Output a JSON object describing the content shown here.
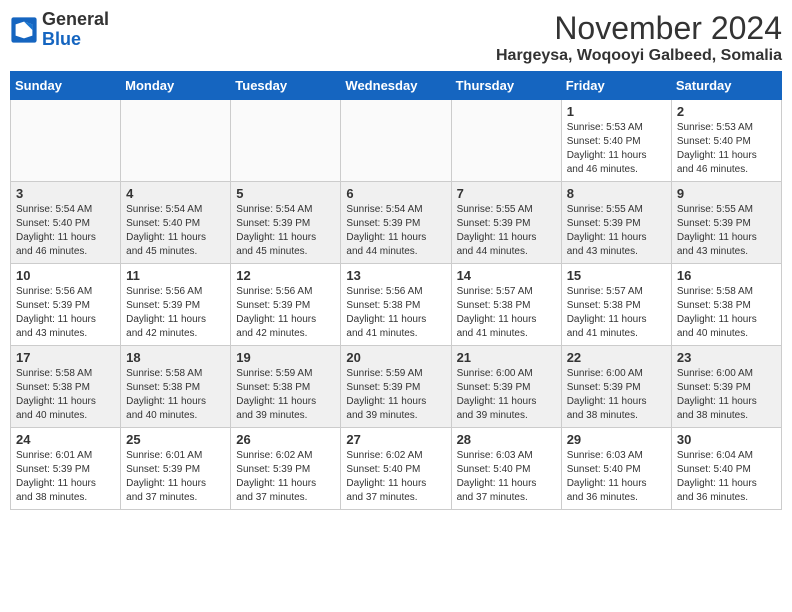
{
  "logo": {
    "general": "General",
    "blue": "Blue"
  },
  "header": {
    "month": "November 2024",
    "location": "Hargeysa, Woqooyi Galbeed, Somalia"
  },
  "weekdays": [
    "Sunday",
    "Monday",
    "Tuesday",
    "Wednesday",
    "Thursday",
    "Friday",
    "Saturday"
  ],
  "weeks": [
    [
      {
        "day": "",
        "info": ""
      },
      {
        "day": "",
        "info": ""
      },
      {
        "day": "",
        "info": ""
      },
      {
        "day": "",
        "info": ""
      },
      {
        "day": "",
        "info": ""
      },
      {
        "day": "1",
        "info": "Sunrise: 5:53 AM\nSunset: 5:40 PM\nDaylight: 11 hours and 46 minutes."
      },
      {
        "day": "2",
        "info": "Sunrise: 5:53 AM\nSunset: 5:40 PM\nDaylight: 11 hours and 46 minutes."
      }
    ],
    [
      {
        "day": "3",
        "info": "Sunrise: 5:54 AM\nSunset: 5:40 PM\nDaylight: 11 hours and 46 minutes."
      },
      {
        "day": "4",
        "info": "Sunrise: 5:54 AM\nSunset: 5:40 PM\nDaylight: 11 hours and 45 minutes."
      },
      {
        "day": "5",
        "info": "Sunrise: 5:54 AM\nSunset: 5:39 PM\nDaylight: 11 hours and 45 minutes."
      },
      {
        "day": "6",
        "info": "Sunrise: 5:54 AM\nSunset: 5:39 PM\nDaylight: 11 hours and 44 minutes."
      },
      {
        "day": "7",
        "info": "Sunrise: 5:55 AM\nSunset: 5:39 PM\nDaylight: 11 hours and 44 minutes."
      },
      {
        "day": "8",
        "info": "Sunrise: 5:55 AM\nSunset: 5:39 PM\nDaylight: 11 hours and 43 minutes."
      },
      {
        "day": "9",
        "info": "Sunrise: 5:55 AM\nSunset: 5:39 PM\nDaylight: 11 hours and 43 minutes."
      }
    ],
    [
      {
        "day": "10",
        "info": "Sunrise: 5:56 AM\nSunset: 5:39 PM\nDaylight: 11 hours and 43 minutes."
      },
      {
        "day": "11",
        "info": "Sunrise: 5:56 AM\nSunset: 5:39 PM\nDaylight: 11 hours and 42 minutes."
      },
      {
        "day": "12",
        "info": "Sunrise: 5:56 AM\nSunset: 5:39 PM\nDaylight: 11 hours and 42 minutes."
      },
      {
        "day": "13",
        "info": "Sunrise: 5:56 AM\nSunset: 5:38 PM\nDaylight: 11 hours and 41 minutes."
      },
      {
        "day": "14",
        "info": "Sunrise: 5:57 AM\nSunset: 5:38 PM\nDaylight: 11 hours and 41 minutes."
      },
      {
        "day": "15",
        "info": "Sunrise: 5:57 AM\nSunset: 5:38 PM\nDaylight: 11 hours and 41 minutes."
      },
      {
        "day": "16",
        "info": "Sunrise: 5:58 AM\nSunset: 5:38 PM\nDaylight: 11 hours and 40 minutes."
      }
    ],
    [
      {
        "day": "17",
        "info": "Sunrise: 5:58 AM\nSunset: 5:38 PM\nDaylight: 11 hours and 40 minutes."
      },
      {
        "day": "18",
        "info": "Sunrise: 5:58 AM\nSunset: 5:38 PM\nDaylight: 11 hours and 40 minutes."
      },
      {
        "day": "19",
        "info": "Sunrise: 5:59 AM\nSunset: 5:38 PM\nDaylight: 11 hours and 39 minutes."
      },
      {
        "day": "20",
        "info": "Sunrise: 5:59 AM\nSunset: 5:39 PM\nDaylight: 11 hours and 39 minutes."
      },
      {
        "day": "21",
        "info": "Sunrise: 6:00 AM\nSunset: 5:39 PM\nDaylight: 11 hours and 39 minutes."
      },
      {
        "day": "22",
        "info": "Sunrise: 6:00 AM\nSunset: 5:39 PM\nDaylight: 11 hours and 38 minutes."
      },
      {
        "day": "23",
        "info": "Sunrise: 6:00 AM\nSunset: 5:39 PM\nDaylight: 11 hours and 38 minutes."
      }
    ],
    [
      {
        "day": "24",
        "info": "Sunrise: 6:01 AM\nSunset: 5:39 PM\nDaylight: 11 hours and 38 minutes."
      },
      {
        "day": "25",
        "info": "Sunrise: 6:01 AM\nSunset: 5:39 PM\nDaylight: 11 hours and 37 minutes."
      },
      {
        "day": "26",
        "info": "Sunrise: 6:02 AM\nSunset: 5:39 PM\nDaylight: 11 hours and 37 minutes."
      },
      {
        "day": "27",
        "info": "Sunrise: 6:02 AM\nSunset: 5:40 PM\nDaylight: 11 hours and 37 minutes."
      },
      {
        "day": "28",
        "info": "Sunrise: 6:03 AM\nSunset: 5:40 PM\nDaylight: 11 hours and 37 minutes."
      },
      {
        "day": "29",
        "info": "Sunrise: 6:03 AM\nSunset: 5:40 PM\nDaylight: 11 hours and 36 minutes."
      },
      {
        "day": "30",
        "info": "Sunrise: 6:04 AM\nSunset: 5:40 PM\nDaylight: 11 hours and 36 minutes."
      }
    ]
  ]
}
